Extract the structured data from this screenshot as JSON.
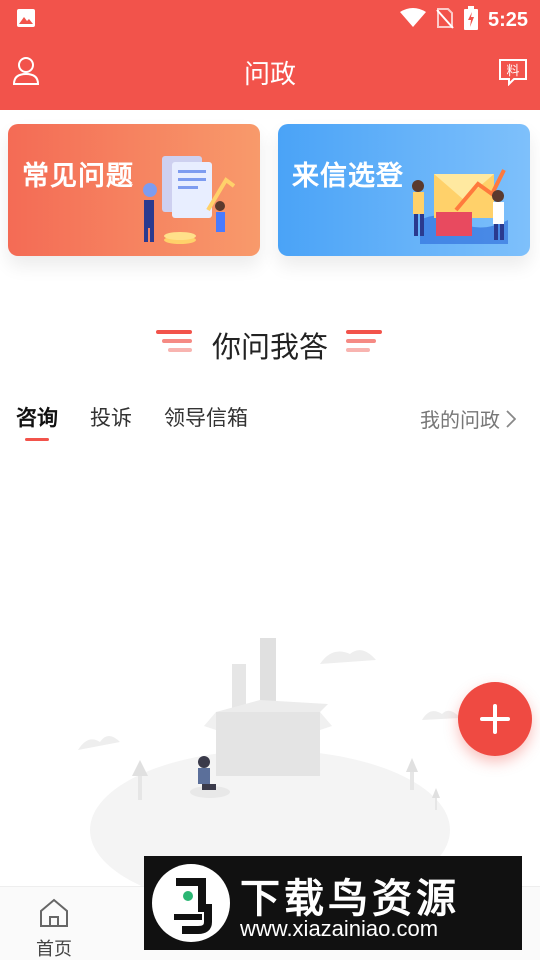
{
  "status_bar": {
    "time": "5:25"
  },
  "header": {
    "title": "问政",
    "left_icon": "user-icon",
    "right_icon": "report-icon",
    "right_icon_glyph": "料",
    "color": "#f2534b"
  },
  "cards": [
    {
      "label": "常见问题",
      "color": "#f46b55"
    },
    {
      "label": "来信选登",
      "color": "#4aa3f7"
    }
  ],
  "section": {
    "title": "你问我答"
  },
  "tabs": [
    {
      "label": "咨询",
      "active": true
    },
    {
      "label": "投诉",
      "active": false
    },
    {
      "label": "领导信箱",
      "active": false
    }
  ],
  "my_link": {
    "label": "我的问政"
  },
  "fab": {
    "icon": "plus-icon"
  },
  "bottom_nav": [
    {
      "label": "首页",
      "icon": "home-icon",
      "active": false
    },
    {
      "label": "",
      "icon": "ask-icon",
      "active": true
    },
    {
      "label": "",
      "icon": "nav-icon",
      "active": false
    },
    {
      "label": "",
      "icon": "service-icon",
      "active": false
    },
    {
      "label": "",
      "icon": "profile-icon",
      "active": false
    }
  ],
  "watermark": {
    "title": "下载鸟资源",
    "url": "www.xiazainiao.com"
  }
}
